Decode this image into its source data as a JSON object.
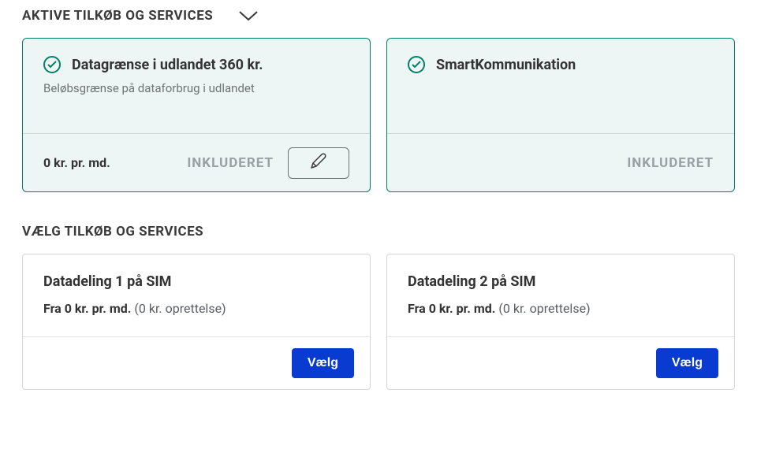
{
  "sections": {
    "active_title": "AKTIVE TILKØB OG SERVICES",
    "select_title": "VÆLG TILKØB OG SERVICES"
  },
  "active": [
    {
      "title": "Datagrænse i udlandet 360 kr.",
      "subtitle": "Beløbsgrænse på dataforbrug i udlandet",
      "price": "0 kr. pr. md.",
      "status": "INKLUDERET",
      "editable": true
    },
    {
      "title": "SmartKommunikation",
      "subtitle": "",
      "price": "",
      "status": "INKLUDERET",
      "editable": false
    }
  ],
  "selectable": [
    {
      "title": "Datadeling 1 på SIM",
      "price_prefix": "Fra 0 kr. pr. md.",
      "price_suffix": "(0 kr. oprettelse)",
      "button": "Vælg"
    },
    {
      "title": "Datadeling 2 på SIM",
      "price_prefix": "Fra 0 kr. pr. md.",
      "price_suffix": "(0 kr. oprettelse)",
      "button": "Vælg"
    }
  ]
}
